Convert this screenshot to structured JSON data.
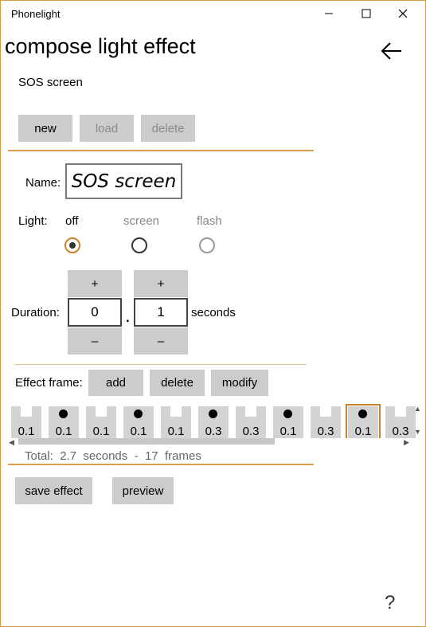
{
  "window": {
    "title": "Phonelight",
    "minimize": "—",
    "maximize": "☐",
    "close": "✕"
  },
  "page": {
    "title": "compose light effect",
    "subtitle": "SOS screen"
  },
  "toolbar": {
    "new": "new",
    "load": "load",
    "delete": "delete"
  },
  "name": {
    "label": "Name:",
    "value": "SOS screen"
  },
  "light": {
    "label": "Light:",
    "options": [
      {
        "label": "off",
        "selected": true,
        "enabled": true
      },
      {
        "label": "screen",
        "selected": false,
        "enabled": true
      },
      {
        "label": "flash",
        "selected": false,
        "enabled": false
      }
    ]
  },
  "duration": {
    "label": "Duration:",
    "whole": "0",
    "fraction": "1",
    "sep": ".",
    "unit": "seconds",
    "plus": "+",
    "minus": "–"
  },
  "effect_frame": {
    "label": "Effect frame:",
    "add": "add",
    "delete": "delete",
    "modify": "modify"
  },
  "frames": [
    {
      "value": "0.1",
      "on": false
    },
    {
      "value": "0.1",
      "on": true
    },
    {
      "value": "0.1",
      "on": false
    },
    {
      "value": "0.1",
      "on": true
    },
    {
      "value": "0.1",
      "on": false
    },
    {
      "value": "0.3",
      "on": true
    },
    {
      "value": "0.3",
      "on": false
    },
    {
      "value": "0.1",
      "on": true
    },
    {
      "value": "0.3",
      "on": false
    },
    {
      "value": "0.1",
      "on": true,
      "selected": true
    },
    {
      "value": "0.3",
      "on": false
    }
  ],
  "totals": {
    "prefix": "Total:",
    "seconds": "2.7",
    "seconds_unit": "seconds",
    "sep": "-",
    "frames": "17",
    "frames_unit": "frames"
  },
  "actions": {
    "save": "save effect",
    "preview": "preview"
  },
  "help": "?",
  "colors": {
    "accent": "#d9a04a",
    "button": "#cccccc"
  }
}
